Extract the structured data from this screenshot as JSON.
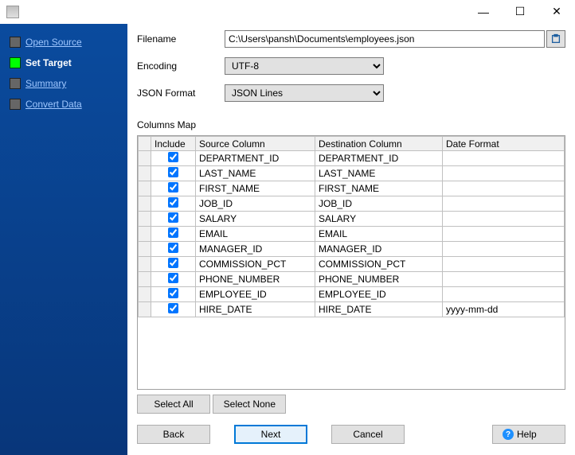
{
  "window": {
    "min_icon": "—",
    "max_icon": "☐",
    "close_icon": "✕"
  },
  "sidebar": {
    "steps": [
      {
        "label": "Open Source"
      },
      {
        "label": "Set Target"
      },
      {
        "label": "Summary"
      },
      {
        "label": "Convert Data"
      }
    ],
    "active_index": 1
  },
  "form": {
    "filename_label": "Filename",
    "filename_value": "C:\\Users\\pansh\\Documents\\employees.json",
    "encoding_label": "Encoding",
    "encoding_value": "UTF-8",
    "json_format_label": "JSON Format",
    "json_format_value": "JSON Lines"
  },
  "columns_map_label": "Columns Map",
  "grid": {
    "headers": {
      "include": "Include",
      "source": "Source Column",
      "destination": "Destination Column",
      "date_format": "Date Format"
    },
    "rows": [
      {
        "include": true,
        "source": "DEPARTMENT_ID",
        "destination": "DEPARTMENT_ID",
        "date_format": ""
      },
      {
        "include": true,
        "source": "LAST_NAME",
        "destination": "LAST_NAME",
        "date_format": ""
      },
      {
        "include": true,
        "source": "FIRST_NAME",
        "destination": "FIRST_NAME",
        "date_format": ""
      },
      {
        "include": true,
        "source": "JOB_ID",
        "destination": "JOB_ID",
        "date_format": ""
      },
      {
        "include": true,
        "source": "SALARY",
        "destination": "SALARY",
        "date_format": ""
      },
      {
        "include": true,
        "source": "EMAIL",
        "destination": "EMAIL",
        "date_format": ""
      },
      {
        "include": true,
        "source": "MANAGER_ID",
        "destination": "MANAGER_ID",
        "date_format": ""
      },
      {
        "include": true,
        "source": "COMMISSION_PCT",
        "destination": "COMMISSION_PCT",
        "date_format": ""
      },
      {
        "include": true,
        "source": "PHONE_NUMBER",
        "destination": "PHONE_NUMBER",
        "date_format": ""
      },
      {
        "include": true,
        "source": "EMPLOYEE_ID",
        "destination": "EMPLOYEE_ID",
        "date_format": ""
      },
      {
        "include": true,
        "source": "HIRE_DATE",
        "destination": "HIRE_DATE",
        "date_format": "yyyy-mm-dd"
      }
    ]
  },
  "buttons": {
    "select_all": "Select All",
    "select_none": "Select None",
    "back": "Back",
    "next": "Next",
    "cancel": "Cancel",
    "help": "Help"
  }
}
